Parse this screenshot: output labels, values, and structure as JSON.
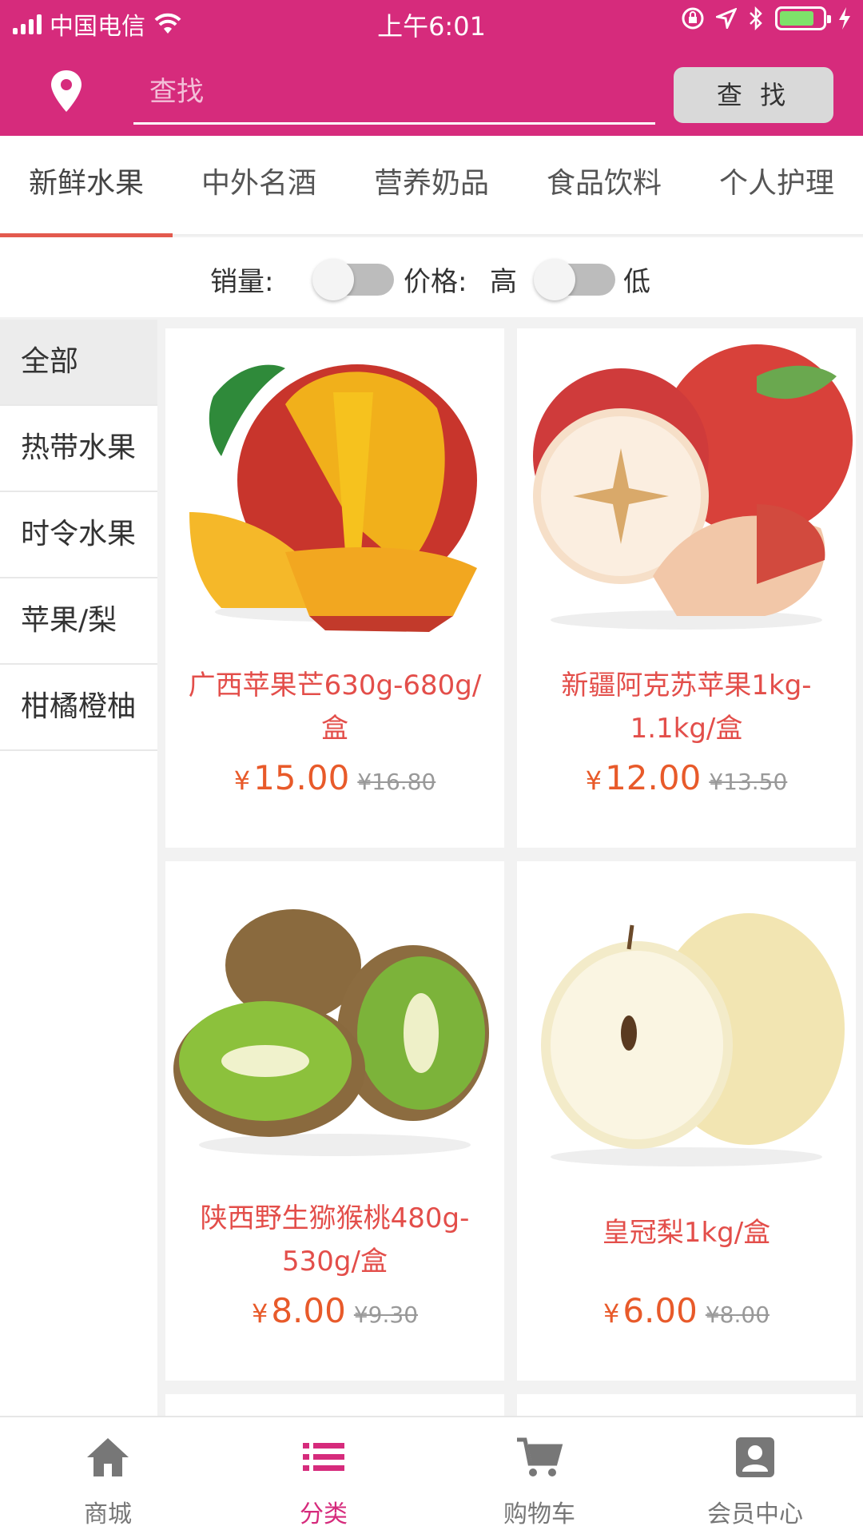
{
  "status_bar": {
    "carrier": "中国电信",
    "time": "上午6:01"
  },
  "header": {
    "search_placeholder": "查找",
    "search_button": "查 找"
  },
  "tabs": [
    {
      "label": "新鲜水果",
      "active": true
    },
    {
      "label": "中外名酒",
      "active": false
    },
    {
      "label": "营养奶品",
      "active": false
    },
    {
      "label": "食品饮料",
      "active": false
    },
    {
      "label": "个人护理",
      "active": false
    }
  ],
  "filter": {
    "sales_label": "销量:",
    "price_label": "价格:",
    "high_label": "高",
    "low_label": "低"
  },
  "sidebar": {
    "items": [
      {
        "label": "全部",
        "active": true
      },
      {
        "label": "热带水果",
        "active": false
      },
      {
        "label": "时令水果",
        "active": false
      },
      {
        "label": "苹果/梨",
        "active": false
      },
      {
        "label": "柑橘橙柚",
        "active": false
      }
    ]
  },
  "products": [
    {
      "name": "广西苹果芒630g-680g/盒",
      "currency": "¥",
      "price": "15.00",
      "old_price": "¥16.80",
      "image": "mango"
    },
    {
      "name": "新疆阿克苏苹果1kg-1.1kg/盒",
      "currency": "¥",
      "price": "12.00",
      "old_price": "¥13.50",
      "image": "apple"
    },
    {
      "name": "陕西野生猕猴桃480g-530g/盒",
      "currency": "¥",
      "price": "8.00",
      "old_price": "¥9.30",
      "image": "kiwi"
    },
    {
      "name": "皇冠梨1kg/盒",
      "currency": "¥",
      "price": "6.00",
      "old_price": "¥8.00",
      "image": "pear"
    }
  ],
  "bottom_nav": [
    {
      "label": "商城",
      "icon": "home-icon",
      "active": false
    },
    {
      "label": "分类",
      "icon": "list-icon",
      "active": true
    },
    {
      "label": "购物车",
      "icon": "cart-icon",
      "active": false
    },
    {
      "label": "会员中心",
      "icon": "user-icon",
      "active": false
    }
  ],
  "colors": {
    "brand": "#d62b7c",
    "tab_underline": "#e35a4e",
    "product_name": "#e34e4a",
    "price": "#e85a2a"
  }
}
